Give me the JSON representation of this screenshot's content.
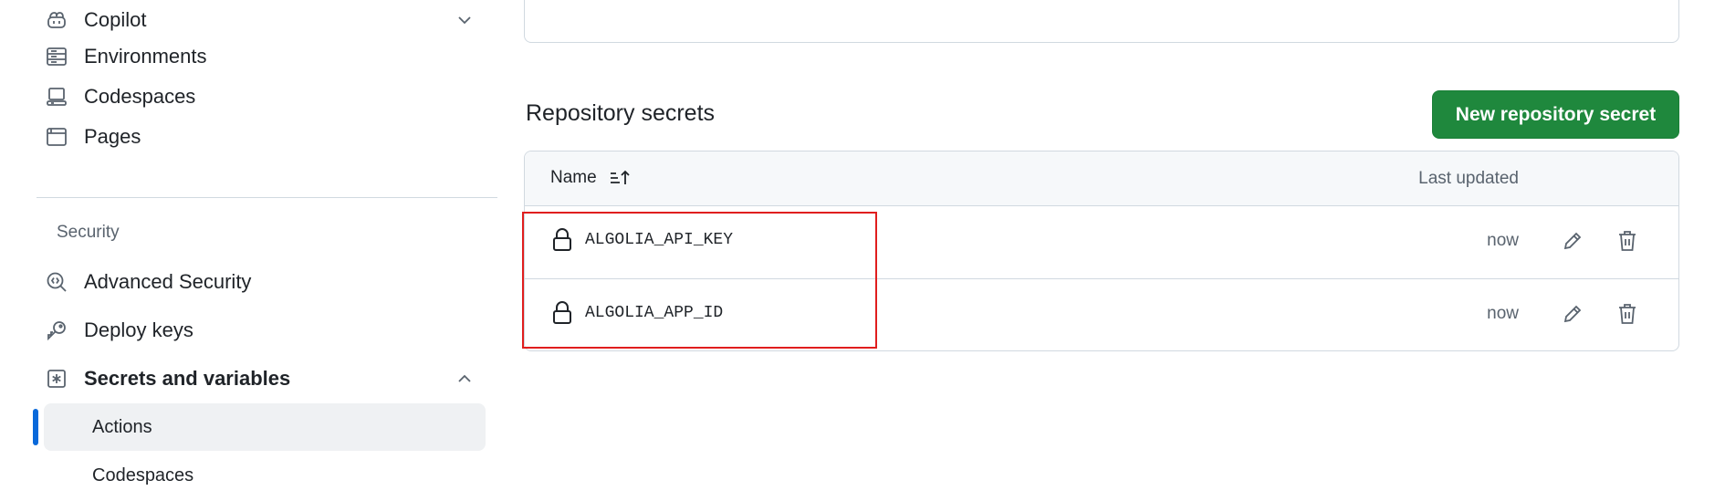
{
  "sidebar": {
    "items": [
      {
        "label": "Copilot",
        "icon": "copilot-icon",
        "chevron": "chevron-down-icon"
      },
      {
        "label": "Environments",
        "icon": "server-icon"
      },
      {
        "label": "Codespaces",
        "icon": "codespaces-icon"
      },
      {
        "label": "Pages",
        "icon": "browser-icon"
      }
    ],
    "security_heading": "Security",
    "security_items": [
      {
        "label": "Advanced Security",
        "icon": "codescan-icon"
      },
      {
        "label": "Deploy keys",
        "icon": "key-icon"
      },
      {
        "label": "Secrets and variables",
        "icon": "asterisk-icon",
        "chevron": "chevron-up-icon"
      }
    ],
    "sub_items": [
      {
        "label": "Actions",
        "active": true
      },
      {
        "label": "Codespaces",
        "active": false
      }
    ]
  },
  "main": {
    "section_title": "Repository secrets",
    "new_button_label": "New repository secret",
    "table": {
      "col_name": "Name",
      "col_updated": "Last updated",
      "rows": [
        {
          "name": "ALGOLIA_API_KEY",
          "updated": "now"
        },
        {
          "name": "ALGOLIA_APP_ID",
          "updated": "now"
        }
      ]
    }
  },
  "colors": {
    "primary_button": "#1f883d",
    "active_indicator": "#0969da",
    "highlight_box": "#e01e1e"
  }
}
